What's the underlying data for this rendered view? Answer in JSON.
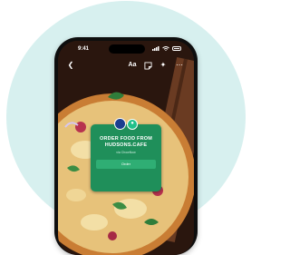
{
  "status_bar": {
    "time": "9:41"
  },
  "toolbar": {
    "back_icon": "chevron-left-icon",
    "text_label": "Aa",
    "sticker_icon": "sticker-icon",
    "effects_icon": "sparkles-icon",
    "more_icon": "more-icon"
  },
  "sticker": {
    "title": "ORDER FOOD FROM HUDSONS.CAFE",
    "subtitle": "via ChowNow",
    "button_label": "Order",
    "colors": {
      "background": "#1f8f5a",
      "button": "#2fae74"
    }
  },
  "colors": {
    "backdrop": "#d7f0ef",
    "phone": "#0e0e0e"
  }
}
